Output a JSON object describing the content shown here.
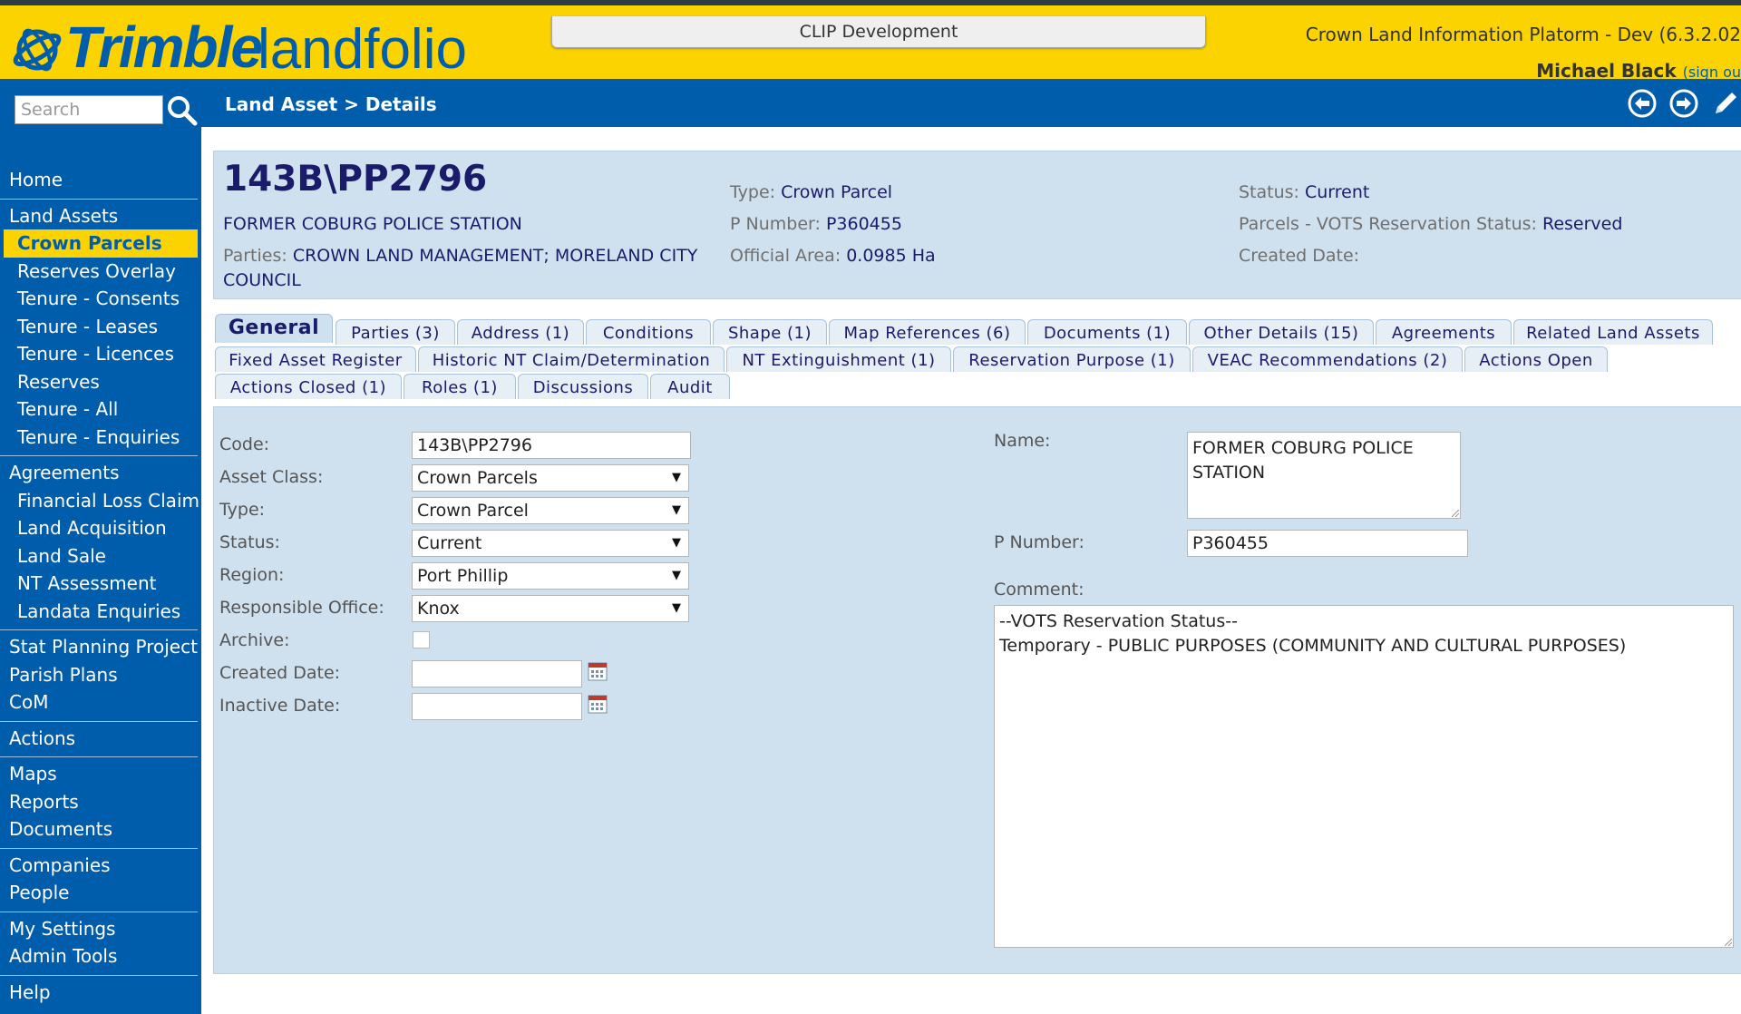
{
  "app": {
    "brand": "Trimble",
    "product": "landfolio",
    "environment": "CLIP Development",
    "title": "Crown Land Information Platorm - Dev (6.3.2.02",
    "user": "Michael Black",
    "signout": "(sign ou"
  },
  "nav": {
    "search_placeholder": "Search",
    "breadcrumb": "Land Asset > Details"
  },
  "sidebar": {
    "home": "Home",
    "land_assets": "Land Assets",
    "crown_parcels": "Crown Parcels",
    "reserves_overlay": "Reserves Overlay",
    "tenure_consents": "Tenure - Consents",
    "tenure_leases": "Tenure - Leases",
    "tenure_licences": "Tenure - Licences",
    "reserves": "Reserves",
    "tenure_all": "Tenure - All",
    "tenure_enquiries": "Tenure - Enquiries",
    "agreements": "Agreements",
    "financial_loss_claim": "Financial Loss Claim",
    "land_acquisition": "Land Acquisition",
    "land_sale": "Land Sale",
    "nt_assessment": "NT Assessment",
    "landata_enquiries": "Landata Enquiries",
    "stat_planning_project": "Stat Planning Project",
    "parish_plans": "Parish Plans",
    "com": "CoM",
    "actions": "Actions",
    "maps": "Maps",
    "reports": "Reports",
    "documents": "Documents",
    "companies": "Companies",
    "people": "People",
    "my_settings": "My Settings",
    "admin_tools": "Admin Tools",
    "help": "Help"
  },
  "summary": {
    "code": "143B\\PP2796",
    "name": "FORMER COBURG POLICE STATION",
    "parties_label": "Parties:",
    "parties_value": "CROWN LAND MANAGEMENT; MORELAND CITY COUNCIL",
    "type_label": "Type:",
    "type_value": "Crown Parcel",
    "pnumber_label": "P Number:",
    "pnumber_value": "P360455",
    "area_label": "Official Area:",
    "area_value": "0.0985 Ha",
    "status_label": "Status:",
    "status_value": "Current",
    "vots_label": "Parcels - VOTS Reservation Status:",
    "vots_value": "Reserved",
    "created_label": "Created Date:"
  },
  "tabs": {
    "general": "General",
    "parties": "Parties (3)",
    "address": "Address (1)",
    "conditions": "Conditions",
    "shape": "Shape (1)",
    "map_references": "Map References (6)",
    "documents": "Documents (1)",
    "other_details": "Other Details (15)",
    "agreements": "Agreements",
    "related_land_assets": "Related Land Assets",
    "fixed_asset_register": "Fixed Asset Register",
    "historic_nt": "Historic NT Claim/Determination",
    "nt_extinguishment": "NT Extinguishment (1)",
    "reservation_purpose": "Reservation Purpose (1)",
    "veac": "VEAC Recommendations (2)",
    "actions_open": "Actions Open",
    "actions_closed": "Actions Closed (1)",
    "roles": "Roles (1)",
    "discussions": "Discussions",
    "audit": "Audit"
  },
  "form": {
    "code_label": "Code:",
    "code_value": "143B\\PP2796",
    "asset_class_label": "Asset Class:",
    "asset_class_value": "Crown Parcels",
    "type_label": "Type:",
    "type_value": "Crown Parcel",
    "status_label": "Status:",
    "status_value": "Current",
    "region_label": "Region:",
    "region_value": "Port Phillip",
    "office_label": "Responsible Office:",
    "office_value": "Knox",
    "archive_label": "Archive:",
    "created_label": "Created Date:",
    "inactive_label": "Inactive Date:",
    "name_label": "Name:",
    "name_value": "FORMER COBURG POLICE STATION",
    "pnumber_label": "P Number:",
    "pnumber_value": "P360455",
    "comment_label": "Comment:",
    "comment_value": "--VOTS Reservation Status--\nTemporary - PUBLIC PURPOSES (COMMUNITY AND CULTURAL PURPOSES)"
  }
}
